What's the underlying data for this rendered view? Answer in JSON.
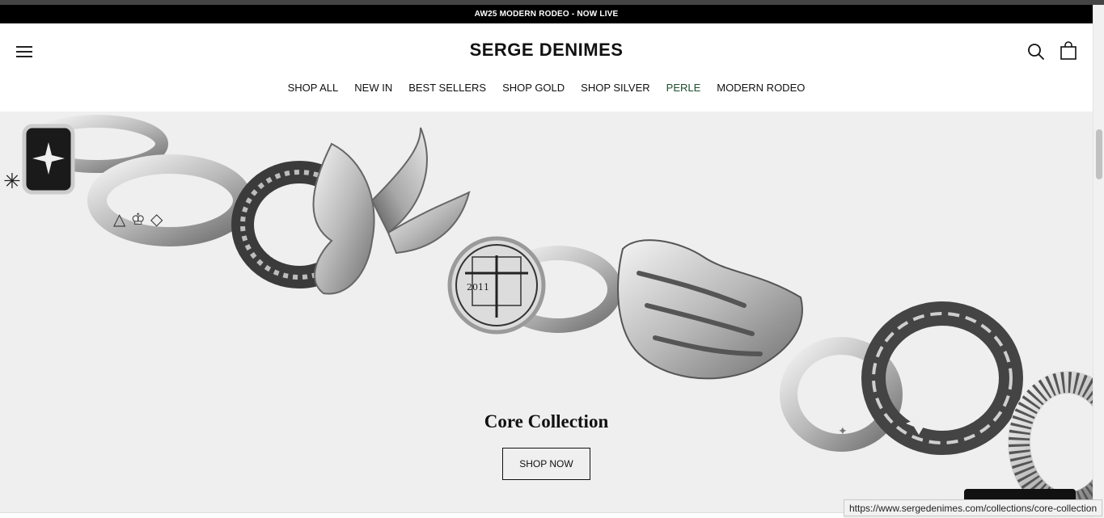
{
  "announcement": {
    "text": "AW25 MODERN RODEO - NOW LIVE"
  },
  "header": {
    "logo": "SERGE DENIMES",
    "menu_icon": "hamburger-icon",
    "search_icon": "search-icon",
    "cart_icon": "shopping-bag-icon"
  },
  "nav": {
    "items": [
      {
        "label": "SHOP ALL"
      },
      {
        "label": "NEW IN"
      },
      {
        "label": "BEST SELLERS"
      },
      {
        "label": "SHOP GOLD"
      },
      {
        "label": "SHOP SILVER"
      },
      {
        "label": "PERLE"
      },
      {
        "label": "MODERN RODEO"
      }
    ],
    "accent_color": "#1f4d2f"
  },
  "hero": {
    "title": "Core Collection",
    "button_label": "SHOP NOW",
    "background_color": "#efefef",
    "ring_engraving": "2011"
  },
  "status_bar": {
    "url": "https://www.sergedenimes.com/collections/core-collection"
  },
  "colors": {
    "announcement_bg": "#000000",
    "text": "#111111"
  }
}
